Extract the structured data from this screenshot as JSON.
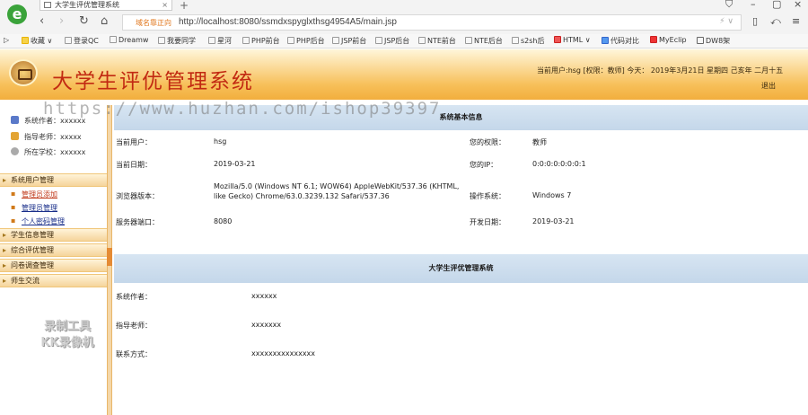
{
  "browser": {
    "tab_title": "大学生评优管理系统",
    "url_warning": "域名靠正向",
    "url": "http://localhost:8080/ssmdxspyglxthsg4954A5/main.jsp",
    "bookmarks": [
      "收藏",
      "登录QC",
      "Dreamw",
      "我要同学",
      "星河",
      "PHP前台",
      "PHP后台",
      "JSP前台",
      "JSP后台",
      "NTE前台",
      "NTE后台",
      "s2sh后",
      "HTML",
      "代码对比",
      "MyEclip",
      "DW8架"
    ]
  },
  "header": {
    "title": "大学生评优管理系统",
    "user_info": "当前用户:hsg [权限：教师] 今天： 2019年3月21日 星期四 己亥年 二月十五",
    "logout": "退出"
  },
  "sidebar": {
    "info": [
      {
        "label": "系统作者：xxxxxx"
      },
      {
        "label": "指导老师：xxxxx"
      },
      {
        "label": "所在学校：xxxxxx"
      }
    ],
    "menus": [
      {
        "label": "系统用户管理",
        "items": [
          "管理员添加",
          "管理员管理",
          "个人密码管理"
        ]
      },
      {
        "label": "学生信息管理"
      },
      {
        "label": "综合评优管理"
      },
      {
        "label": "问卷调查管理"
      },
      {
        "label": "师生交流"
      }
    ],
    "recorder_watermark": "录制工具 KK录像机"
  },
  "main": {
    "overlay_watermark": "https://www.huzhan.com/ishop39397",
    "section1_title": "系统基本信息",
    "rows": [
      {
        "k1": "当前用户：",
        "v1": "hsg",
        "k2": "您的权限：",
        "v2": "教师"
      },
      {
        "k1": "当前日期：",
        "v1": "2019-03-21",
        "k2": "您的IP：",
        "v2": "0:0:0:0:0:0:0:1"
      },
      {
        "k1": "浏览器版本：",
        "v1": "Mozilla/5.0 (Windows NT 6.1; WOW64) AppleWebKit/537.36 (KHTML, like Gecko) Chrome/63.0.3239.132 Safari/537.36",
        "k2": "操作系统：",
        "v2": "Windows 7"
      },
      {
        "k1": "服务器端口：",
        "v1": "8080",
        "k2": "开发日期：",
        "v2": "2019-03-21"
      }
    ],
    "section2_title": "大学生评优管理系统",
    "rows2": [
      {
        "k": "系统作者：",
        "v": "xxxxxx"
      },
      {
        "k": "指导老师：",
        "v": "xxxxxxx"
      },
      {
        "k": "联系方式：",
        "v": "xxxxxxxxxxxxxxx"
      }
    ]
  }
}
